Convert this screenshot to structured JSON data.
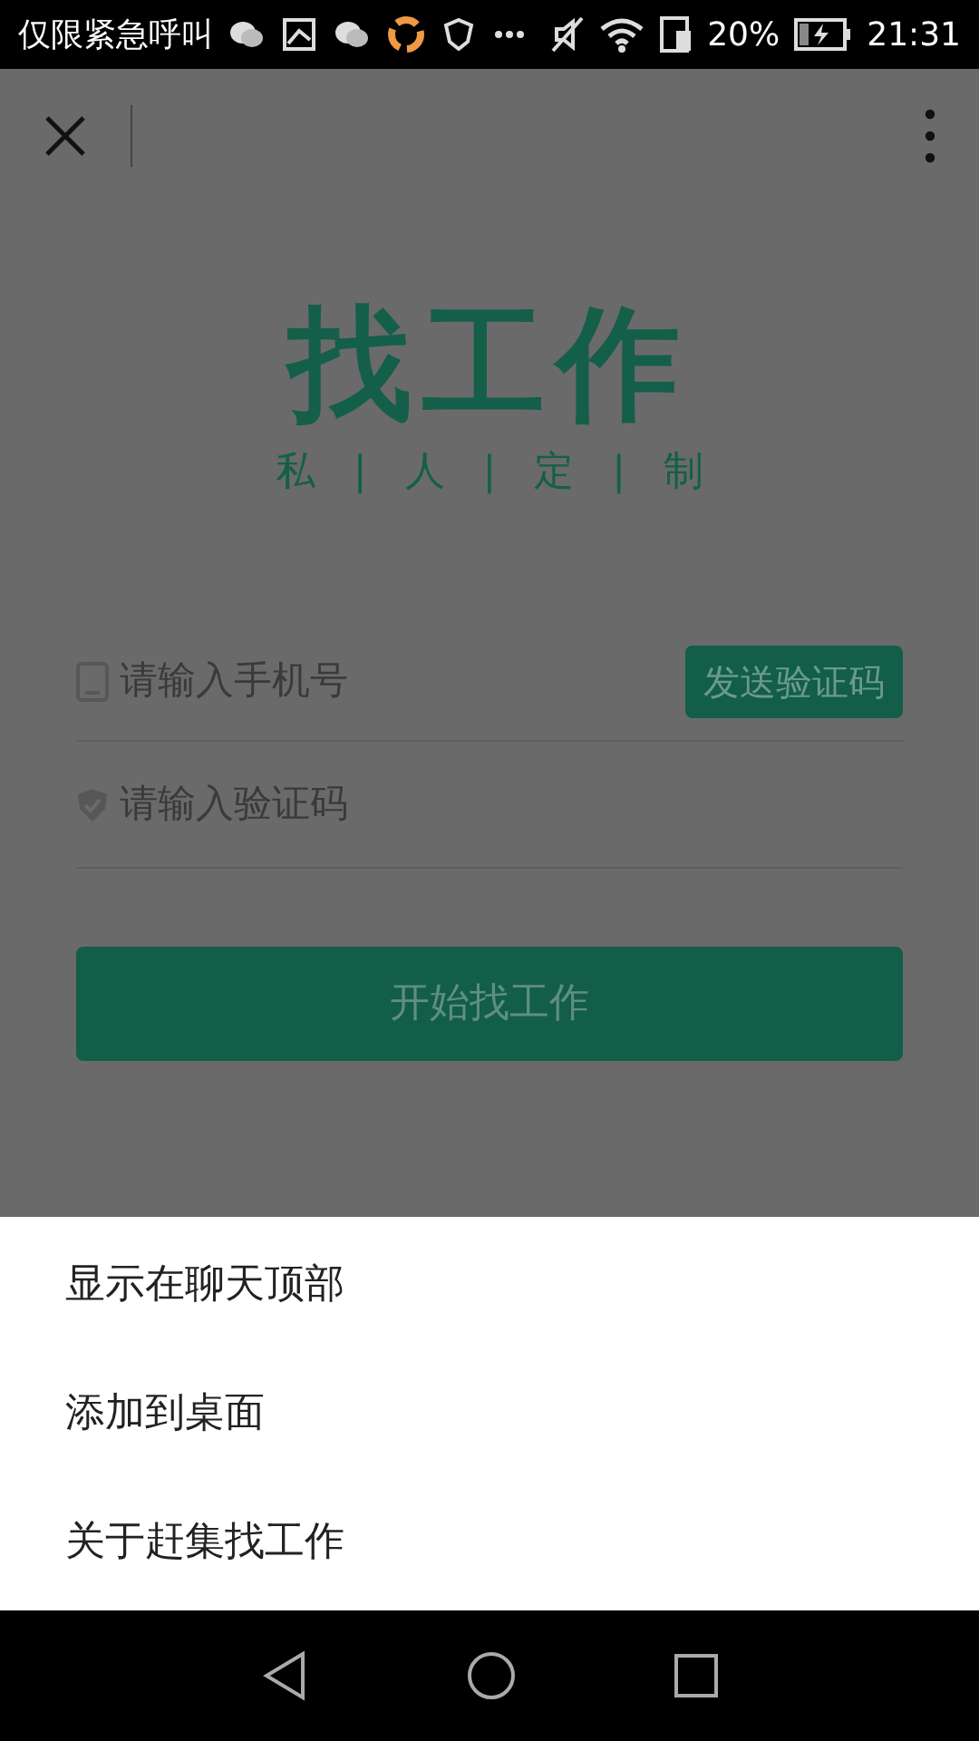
{
  "status_bar": {
    "notice": "仅限紧急呼叫",
    "battery": "20%",
    "time": "21:31"
  },
  "logo": {
    "title": "找工作",
    "subtitle": "私 | 人 | 定 | 制"
  },
  "phone_field": {
    "placeholder": "请输入手机号"
  },
  "send_code_button": {
    "label": "发送验证码"
  },
  "code_field": {
    "placeholder": "请输入验证码"
  },
  "submit_button": {
    "label": "开始找工作"
  },
  "menu": {
    "items": [
      {
        "label": "显示在聊天顶部"
      },
      {
        "label": "添加到桌面"
      },
      {
        "label": "关于赶集找工作"
      }
    ]
  }
}
